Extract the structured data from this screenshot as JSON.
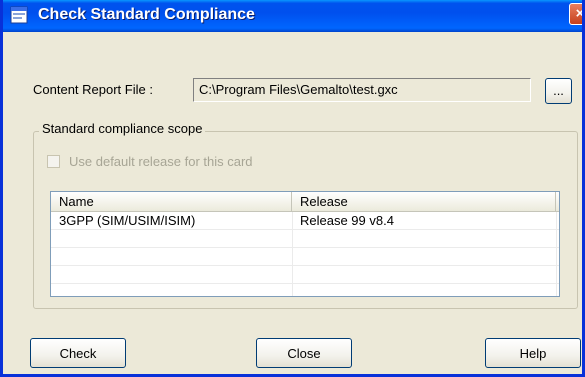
{
  "window": {
    "title": "Check Standard Compliance",
    "close_glyph": "×"
  },
  "report": {
    "label": "Content Report File :",
    "value": "C:\\Program Files\\Gemalto\\test.gxc",
    "browse_label": "..."
  },
  "scope": {
    "legend": "Standard compliance scope",
    "checkbox_label": "Use default release for this card",
    "checkbox_checked": false,
    "columns": [
      "Name",
      "Release"
    ],
    "rows": [
      {
        "name": "3GPP (SIM/USIM/ISIM)",
        "release": "Release 99 v8.4"
      }
    ]
  },
  "buttons": {
    "check": "Check",
    "close": "Close",
    "help": "Help"
  },
  "colors": {
    "titlebar": "#0053ee",
    "dialog_bg": "#ece9d8",
    "close_button": "#c6401d"
  },
  "icons": {
    "title": "application-window-icon",
    "close": "close-icon"
  }
}
